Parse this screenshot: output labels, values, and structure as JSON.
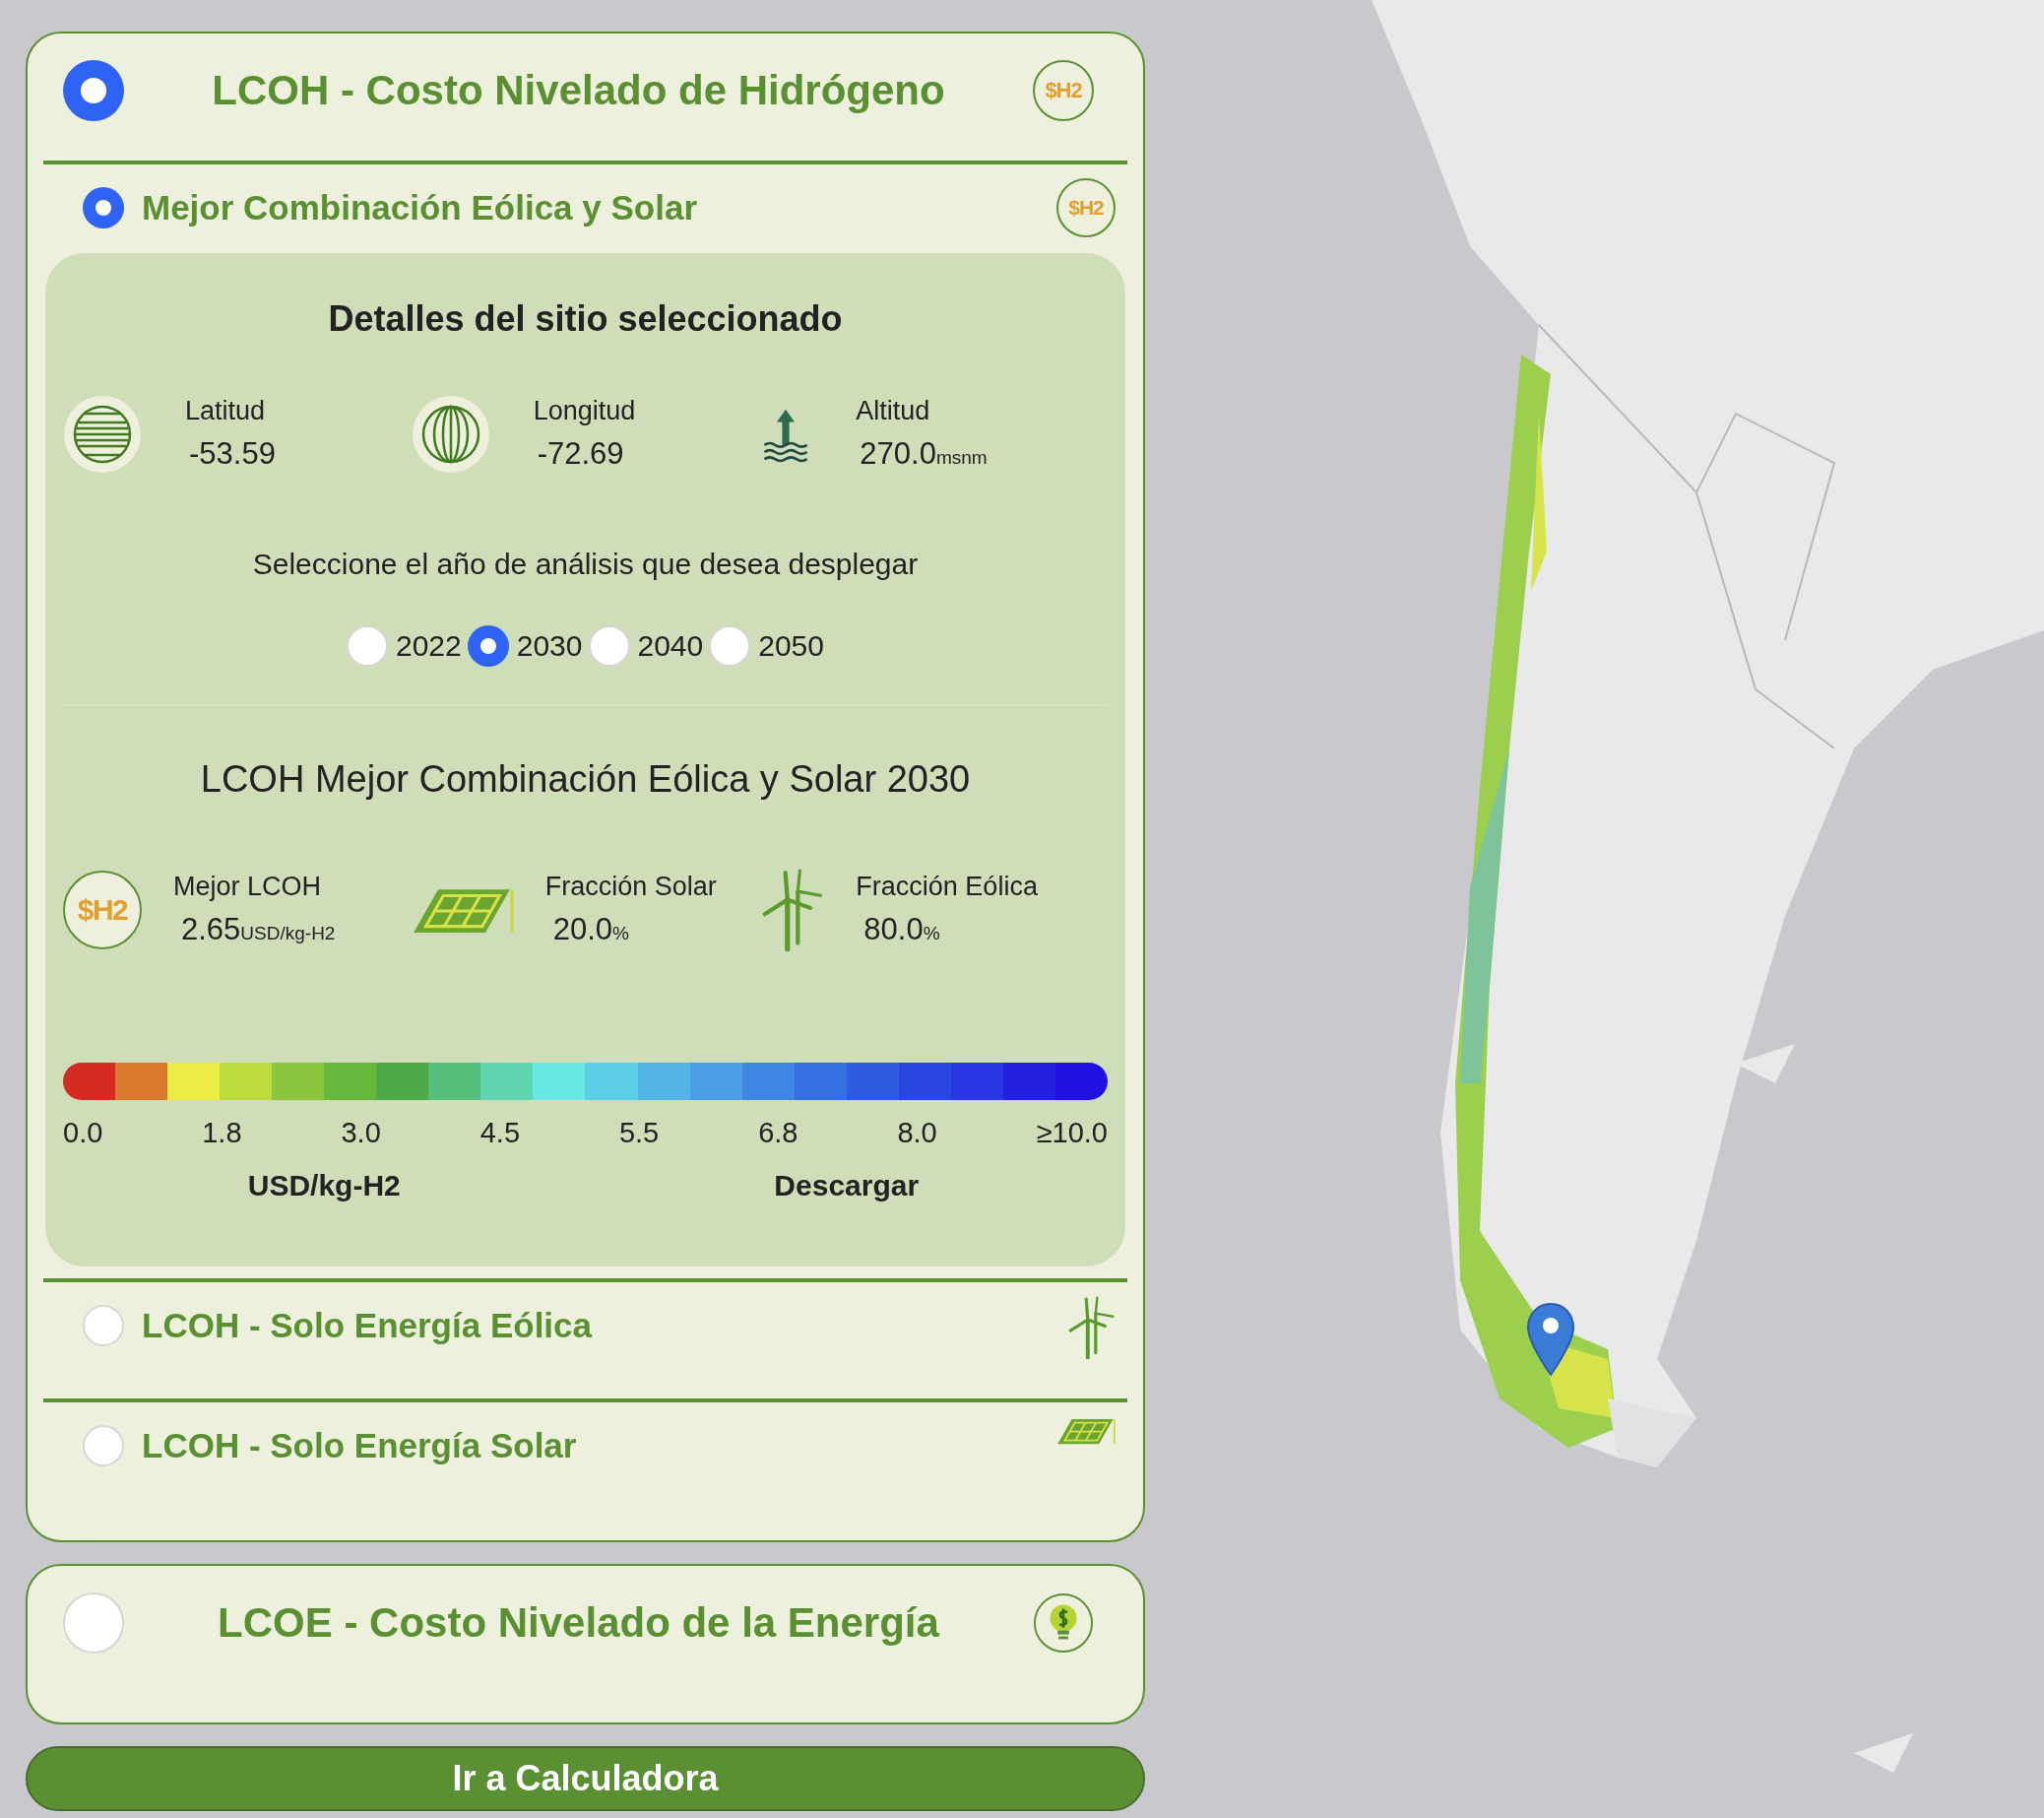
{
  "sections": [
    {
      "title": "LCOH - Costo Nivelado de Hidrógeno",
      "selected": true,
      "kind": "h2",
      "badge": "$H2",
      "options": [
        {
          "title": "Mejor Combinación Eólica y Solar",
          "selected": true,
          "kind": "h2",
          "badge": "$H2",
          "details": {
            "title": "Detalles del sitio seleccionado",
            "site": [
              {
                "kind": "latitude",
                "label": "Latitud",
                "value": "-53.59"
              },
              {
                "kind": "longitude",
                "label": "Longitud",
                "value": "-72.69"
              },
              {
                "kind": "altitude",
                "label": "Altitud",
                "value": "270.0",
                "unit": "msnm"
              }
            ],
            "year_prompt": "Seleccione el año de análisis que desea desplegar",
            "years": [
              {
                "label": "2022",
                "selected": false
              },
              {
                "label": "2030",
                "selected": true
              },
              {
                "label": "2040",
                "selected": false
              },
              {
                "label": "2050",
                "selected": false
              }
            ],
            "result_title": "LCOH Mejor Combinación Eólica y Solar 2030",
            "results": [
              {
                "kind": "h2",
                "badge": "$H2",
                "label": "Mejor LCOH",
                "value": "2.65",
                "unit": "USD/kg-H2"
              },
              {
                "kind": "solar",
                "label": "Fracción Solar",
                "value": "20.0",
                "unit": "%"
              },
              {
                "kind": "wind",
                "label": "Fracción Eólica",
                "value": "80.0",
                "unit": "%"
              }
            ],
            "legend": {
              "colors": [
                {
                  "color": "#d42b22"
                },
                {
                  "color": "#d97a2f"
                },
                {
                  "color": "#ecec44"
                },
                {
                  "color": "#bddc3e"
                },
                {
                  "color": "#8cc63f"
                },
                {
                  "color": "#66b83d"
                },
                {
                  "color": "#4ea947"
                },
                {
                  "color": "#55be7a"
                },
                {
                  "color": "#61d4b2"
                },
                {
                  "color": "#6ae8e6"
                },
                {
                  "color": "#5bcfe5"
                },
                {
                  "color": "#52b5e6"
                },
                {
                  "color": "#4b9fe6"
                },
                {
                  "color": "#3f85e3"
                },
                {
                  "color": "#3470e0"
                },
                {
                  "color": "#2d5ce0"
                },
                {
                  "color": "#2947e0"
                },
                {
                  "color": "#2636e2"
                },
                {
                  "color": "#2320e0"
                },
                {
                  "color": "#1f12e0"
                }
              ],
              "ticks": [
                "0.0",
                "1.8",
                "3.0",
                "4.5",
                "5.5",
                "6.8",
                "8.0",
                "≥10.0"
              ],
              "unit": "USD/kg-H2",
              "download": "Descargar"
            }
          }
        },
        {
          "title": "LCOH - Solo Energía Eólica",
          "selected": false,
          "kind": "wind"
        },
        {
          "title": "LCOH - Solo Energía Solar",
          "selected": false,
          "kind": "solar"
        }
      ]
    },
    {
      "title": "LCOE - Costo Nivelado de la Energía",
      "selected": false,
      "kind": "bulb"
    }
  ],
  "button": "Ir a Calculadora"
}
